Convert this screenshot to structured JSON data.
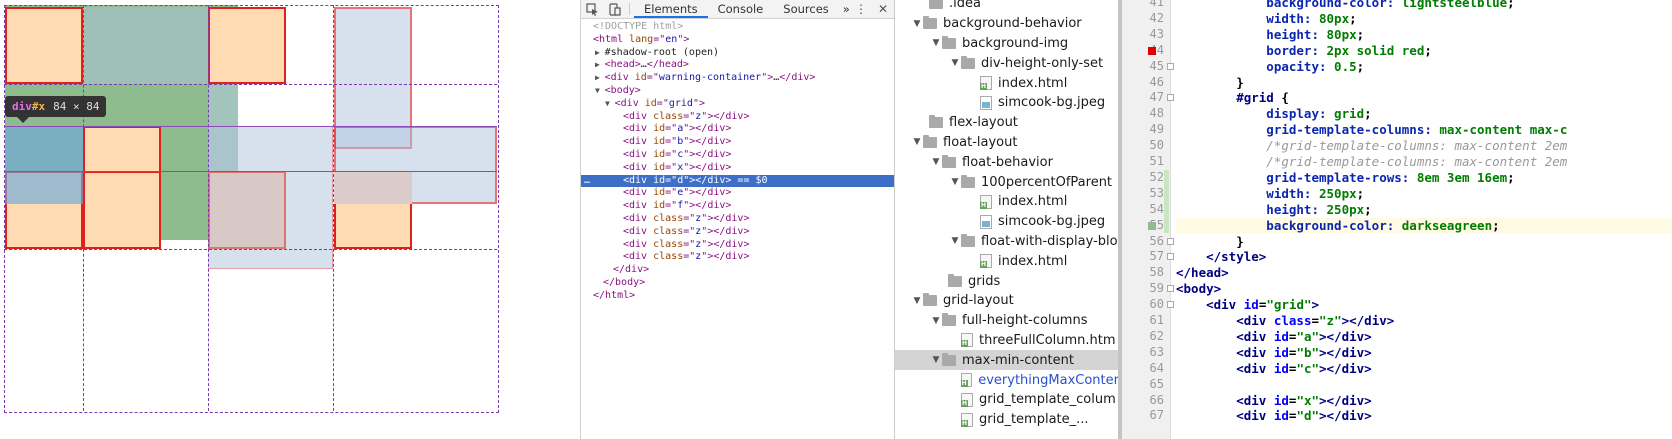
{
  "preview": {
    "tooltip": {
      "tag": "div",
      "id": "#x",
      "dims": "84 × 84"
    }
  },
  "devtools": {
    "tabs": [
      "Elements",
      "Console",
      "Sources"
    ],
    "more": "»",
    "dom_lines": [
      {
        "indent": 0,
        "tri": "",
        "parts": [
          [
            "cm",
            "<!DOCTYPE html>"
          ]
        ]
      },
      {
        "indent": 0,
        "tri": "",
        "parts": [
          [
            "t",
            "<html "
          ],
          [
            "an",
            "lang"
          ],
          [
            "t",
            "=\""
          ],
          [
            "av",
            "en"
          ],
          [
            "t",
            "\">"
          ]
        ]
      },
      {
        "indent": 1,
        "tri": "▶",
        "parts": [
          [
            "blk",
            "#shadow-root (open)"
          ]
        ]
      },
      {
        "indent": 1,
        "tri": "▶",
        "parts": [
          [
            "t",
            "<head>"
          ],
          [
            "blk",
            "…"
          ],
          [
            "t",
            "</head>"
          ]
        ]
      },
      {
        "indent": 1,
        "tri": "▶",
        "parts": [
          [
            "t",
            "<div "
          ],
          [
            "an",
            "id"
          ],
          [
            "t",
            "=\""
          ],
          [
            "av",
            "warning-container"
          ],
          [
            "t",
            "\">"
          ],
          [
            "blk",
            "…"
          ],
          [
            "t",
            "</div>"
          ]
        ]
      },
      {
        "indent": 1,
        "tri": "▼",
        "parts": [
          [
            "t",
            "<body>"
          ]
        ]
      },
      {
        "indent": 2,
        "tri": "▼",
        "parts": [
          [
            "t",
            "<div "
          ],
          [
            "an",
            "id"
          ],
          [
            "t",
            "=\""
          ],
          [
            "av",
            "grid"
          ],
          [
            "t",
            "\">"
          ]
        ]
      },
      {
        "indent": 3,
        "tri": "",
        "parts": [
          [
            "t",
            "<div "
          ],
          [
            "an",
            "class"
          ],
          [
            "t",
            "=\""
          ],
          [
            "av",
            "z"
          ],
          [
            "t",
            "\"></div>"
          ]
        ]
      },
      {
        "indent": 3,
        "tri": "",
        "parts": [
          [
            "t",
            "<div "
          ],
          [
            "an",
            "id"
          ],
          [
            "t",
            "=\""
          ],
          [
            "av",
            "a"
          ],
          [
            "t",
            "\"></div>"
          ]
        ]
      },
      {
        "indent": 3,
        "tri": "",
        "parts": [
          [
            "t",
            "<div "
          ],
          [
            "an",
            "id"
          ],
          [
            "t",
            "=\""
          ],
          [
            "av",
            "b"
          ],
          [
            "t",
            "\"></div>"
          ]
        ]
      },
      {
        "indent": 3,
        "tri": "",
        "parts": [
          [
            "t",
            "<div "
          ],
          [
            "an",
            "id"
          ],
          [
            "t",
            "=\""
          ],
          [
            "av",
            "c"
          ],
          [
            "t",
            "\"></div>"
          ]
        ]
      },
      {
        "indent": 3,
        "tri": "",
        "parts": [
          [
            "t",
            "<div "
          ],
          [
            "an",
            "id"
          ],
          [
            "t",
            "=\""
          ],
          [
            "av",
            "x"
          ],
          [
            "t",
            "\"></div>"
          ]
        ]
      },
      {
        "indent": 3,
        "tri": "",
        "sel": true,
        "parts": [
          [
            "t",
            "<div "
          ],
          [
            "an",
            "id"
          ],
          [
            "t",
            "=\""
          ],
          [
            "av",
            "d"
          ],
          [
            "t",
            "\"></div>"
          ],
          [
            "blk",
            " == $0"
          ]
        ]
      },
      {
        "indent": 3,
        "tri": "",
        "parts": [
          [
            "t",
            "<div "
          ],
          [
            "an",
            "id"
          ],
          [
            "t",
            "=\""
          ],
          [
            "av",
            "e"
          ],
          [
            "t",
            "\"></div>"
          ]
        ]
      },
      {
        "indent": 3,
        "tri": "",
        "parts": [
          [
            "t",
            "<div "
          ],
          [
            "an",
            "id"
          ],
          [
            "t",
            "=\""
          ],
          [
            "av",
            "f"
          ],
          [
            "t",
            "\"></div>"
          ]
        ]
      },
      {
        "indent": 3,
        "tri": "",
        "parts": [
          [
            "t",
            "<div "
          ],
          [
            "an",
            "class"
          ],
          [
            "t",
            "=\""
          ],
          [
            "av",
            "z"
          ],
          [
            "t",
            "\"></div>"
          ]
        ]
      },
      {
        "indent": 3,
        "tri": "",
        "parts": [
          [
            "t",
            "<div "
          ],
          [
            "an",
            "class"
          ],
          [
            "t",
            "=\""
          ],
          [
            "av",
            "z"
          ],
          [
            "t",
            "\"></div>"
          ]
        ]
      },
      {
        "indent": 3,
        "tri": "",
        "parts": [
          [
            "t",
            "<div "
          ],
          [
            "an",
            "class"
          ],
          [
            "t",
            "=\""
          ],
          [
            "av",
            "z"
          ],
          [
            "t",
            "\"></div>"
          ]
        ]
      },
      {
        "indent": 3,
        "tri": "",
        "parts": [
          [
            "t",
            "<div "
          ],
          [
            "an",
            "class"
          ],
          [
            "t",
            "=\""
          ],
          [
            "av",
            "z"
          ],
          [
            "t",
            "\"></div>"
          ]
        ]
      },
      {
        "indent": 2,
        "tri": "",
        "parts": [
          [
            "t",
            "</div>"
          ]
        ]
      },
      {
        "indent": 1,
        "tri": "",
        "parts": [
          [
            "t",
            "</body>"
          ]
        ]
      },
      {
        "indent": 0,
        "tri": "",
        "parts": [
          [
            "t",
            "</html>"
          ]
        ]
      }
    ],
    "selected_marker": "…"
  },
  "tree": {
    "items": [
      {
        "depth": 1,
        "arrow": "",
        "icon": "folder",
        "label": ".idea",
        "partial": true
      },
      {
        "depth": 1,
        "arrow": "▼",
        "icon": "folder",
        "label": "background-behavior"
      },
      {
        "depth": 2,
        "arrow": "▼",
        "icon": "folder",
        "label": "background-img"
      },
      {
        "depth": 3,
        "arrow": "▼",
        "icon": "folder",
        "label": "div-height-only-set"
      },
      {
        "depth": 4,
        "arrow": "",
        "icon": "html",
        "label": "index.html"
      },
      {
        "depth": 4,
        "arrow": "",
        "icon": "image",
        "label": "simcook-bg.jpeg"
      },
      {
        "depth": 1,
        "arrow": "",
        "icon": "folder",
        "label": "flex-layout"
      },
      {
        "depth": 1,
        "arrow": "▼",
        "icon": "folder",
        "label": "float-layout"
      },
      {
        "depth": 2,
        "arrow": "▼",
        "icon": "folder",
        "label": "float-behavior"
      },
      {
        "depth": 3,
        "arrow": "▼",
        "icon": "folder",
        "label": "100percentOfParent"
      },
      {
        "depth": 4,
        "arrow": "",
        "icon": "html",
        "label": "index.html"
      },
      {
        "depth": 4,
        "arrow": "",
        "icon": "image",
        "label": "simcook-bg.jpeg"
      },
      {
        "depth": 3,
        "arrow": "▼",
        "icon": "folder",
        "label": "float-with-display-blo"
      },
      {
        "depth": 4,
        "arrow": "",
        "icon": "html",
        "label": "index.html"
      },
      {
        "depth": 2,
        "arrow": "",
        "icon": "folder",
        "label": "grids"
      },
      {
        "depth": 1,
        "arrow": "▼",
        "icon": "folder",
        "label": "grid-layout"
      },
      {
        "depth": 2,
        "arrow": "▼",
        "icon": "folder",
        "label": "full-height-columns"
      },
      {
        "depth": 3,
        "arrow": "",
        "icon": "html",
        "label": "threeFullColumn.htm"
      },
      {
        "depth": 2,
        "arrow": "▼",
        "icon": "folder",
        "label": "max-min-content",
        "sel": true
      },
      {
        "depth": 3,
        "arrow": "",
        "icon": "html",
        "label": "everythingMaxConter",
        "blue": true
      },
      {
        "depth": 3,
        "arrow": "",
        "icon": "html",
        "label": "grid_template_colum"
      },
      {
        "depth": 3,
        "arrow": "",
        "icon": "html",
        "label": "grid_template_..."
      }
    ]
  },
  "editor": {
    "lines": [
      {
        "n": "41",
        "parts": [
          [
            "kp",
            "            background-color: "
          ],
          [
            "kv",
            "lightsteelblue"
          ],
          [
            "ktext",
            ";"
          ]
        ]
      },
      {
        "n": "42",
        "parts": [
          [
            "kp",
            "            width: "
          ],
          [
            "kv",
            "80px"
          ],
          [
            "ktext",
            ";"
          ]
        ]
      },
      {
        "n": "43",
        "parts": [
          [
            "kp",
            "            height: "
          ],
          [
            "kv",
            "80px"
          ],
          [
            "ktext",
            ";"
          ]
        ]
      },
      {
        "n": "44",
        "parts": [
          [
            "kp",
            "            border: "
          ],
          [
            "kv",
            "2px solid red"
          ],
          [
            "ktext",
            ";"
          ]
        ],
        "marker": "red"
      },
      {
        "n": "45",
        "parts": [
          [
            "kp",
            "            opacity: "
          ],
          [
            "kv",
            "0.5"
          ],
          [
            "ktext",
            ";"
          ]
        ]
      },
      {
        "n": "46",
        "parts": [
          [
            "ktext",
            "        }"
          ]
        ]
      },
      {
        "n": "47",
        "parts": [
          [
            "kt",
            "        #grid "
          ],
          [
            "ktext",
            "{"
          ]
        ]
      },
      {
        "n": "48",
        "parts": [
          [
            "kp",
            "            display: "
          ],
          [
            "kv",
            "grid"
          ],
          [
            "ktext",
            ";"
          ]
        ]
      },
      {
        "n": "49",
        "parts": [
          [
            "kp",
            "            grid-template-columns: "
          ],
          [
            "kv",
            "max-content max-c"
          ]
        ]
      },
      {
        "n": "50",
        "parts": [
          [
            "kc",
            "            /*grid-template-columns: max-content 2em"
          ]
        ]
      },
      {
        "n": "51",
        "parts": [
          [
            "kc",
            "            /*grid-template-columns: max-content 2em"
          ]
        ]
      },
      {
        "n": "52",
        "parts": [
          [
            "kp",
            "            grid-template-rows: "
          ],
          [
            "kv",
            "8em 3em 16em"
          ],
          [
            "ktext",
            ";"
          ]
        ]
      },
      {
        "n": "53",
        "parts": [
          [
            "kp",
            "            width: "
          ],
          [
            "kv",
            "250px"
          ],
          [
            "ktext",
            ";"
          ]
        ]
      },
      {
        "n": "54",
        "parts": [
          [
            "kp",
            "            height: "
          ],
          [
            "kv",
            "250px"
          ],
          [
            "ktext",
            ";"
          ]
        ]
      },
      {
        "n": "55",
        "parts": [
          [
            "kp",
            "            background-color: "
          ],
          [
            "kv",
            "darkseagreen"
          ],
          [
            "ktext",
            ";"
          ]
        ],
        "marker": "green",
        "cur": true
      },
      {
        "n": "56",
        "parts": [
          [
            "ktext",
            "        }"
          ]
        ]
      },
      {
        "n": "57",
        "parts": [
          [
            "ktext",
            "    "
          ],
          [
            "kt",
            "</style>"
          ]
        ]
      },
      {
        "n": "58",
        "parts": [
          [
            "kt",
            "</head>"
          ]
        ]
      },
      {
        "n": "59",
        "parts": [
          [
            "kt",
            "<body>"
          ]
        ]
      },
      {
        "n": "60",
        "parts": [
          [
            "ktext",
            "    "
          ],
          [
            "kt",
            "<div "
          ],
          [
            "ka",
            "id"
          ],
          [
            "ktext",
            "="
          ],
          [
            "ks",
            "\"grid\""
          ],
          [
            "kt",
            ">"
          ]
        ]
      },
      {
        "n": "61",
        "parts": [
          [
            "ktext",
            "        "
          ],
          [
            "kt",
            "<div "
          ],
          [
            "ka",
            "class"
          ],
          [
            "ktext",
            "="
          ],
          [
            "ks",
            "\"z\""
          ],
          [
            "kt",
            "></div>"
          ]
        ]
      },
      {
        "n": "62",
        "parts": [
          [
            "ktext",
            "        "
          ],
          [
            "kt",
            "<div "
          ],
          [
            "ka",
            "id"
          ],
          [
            "ktext",
            "="
          ],
          [
            "ks",
            "\"a\""
          ],
          [
            "kt",
            "></div>"
          ]
        ]
      },
      {
        "n": "63",
        "parts": [
          [
            "ktext",
            "        "
          ],
          [
            "kt",
            "<div "
          ],
          [
            "ka",
            "id"
          ],
          [
            "ktext",
            "="
          ],
          [
            "ks",
            "\"b\""
          ],
          [
            "kt",
            "></div>"
          ]
        ]
      },
      {
        "n": "64",
        "parts": [
          [
            "ktext",
            "        "
          ],
          [
            "kt",
            "<div "
          ],
          [
            "ka",
            "id"
          ],
          [
            "ktext",
            "="
          ],
          [
            "ks",
            "\"c\""
          ],
          [
            "kt",
            "></div>"
          ]
        ]
      },
      {
        "n": "65",
        "parts": [
          [
            "ktext",
            ""
          ]
        ]
      },
      {
        "n": "66",
        "parts": [
          [
            "ktext",
            "        "
          ],
          [
            "kt",
            "<div "
          ],
          [
            "ka",
            "id"
          ],
          [
            "ktext",
            "="
          ],
          [
            "ks",
            "\"x\""
          ],
          [
            "kt",
            "></div>"
          ]
        ]
      },
      {
        "n": "67",
        "parts": [
          [
            "ktext",
            "        "
          ],
          [
            "kt",
            "<div "
          ],
          [
            "ka",
            "id"
          ],
          [
            "ktext",
            "="
          ],
          [
            "ks",
            "\"d\""
          ],
          [
            "kt",
            "></div>"
          ]
        ]
      }
    ]
  }
}
